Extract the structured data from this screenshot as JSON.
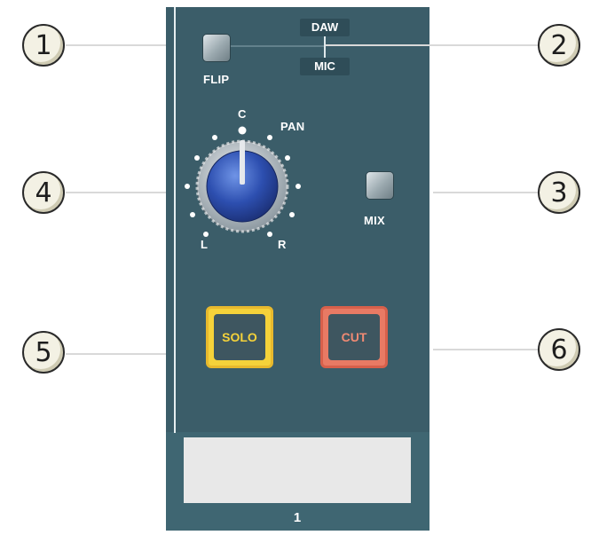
{
  "callouts": [
    "1",
    "2",
    "3",
    "4",
    "5",
    "6"
  ],
  "routing": {
    "top_label": "DAW",
    "bottom_label": "MIC"
  },
  "flip_label": "FLIP",
  "pan": {
    "title": "PAN",
    "center_label": "C",
    "left_label": "L",
    "right_label": "R"
  },
  "mix_label": "MIX",
  "solo_label": "SOLO",
  "cut_label": "CUT",
  "channel_number": "1",
  "colors": {
    "panel": "#3b5d69",
    "solo": "#f5d23a",
    "cut": "#e87a64",
    "knob": "#2d4fb0"
  }
}
